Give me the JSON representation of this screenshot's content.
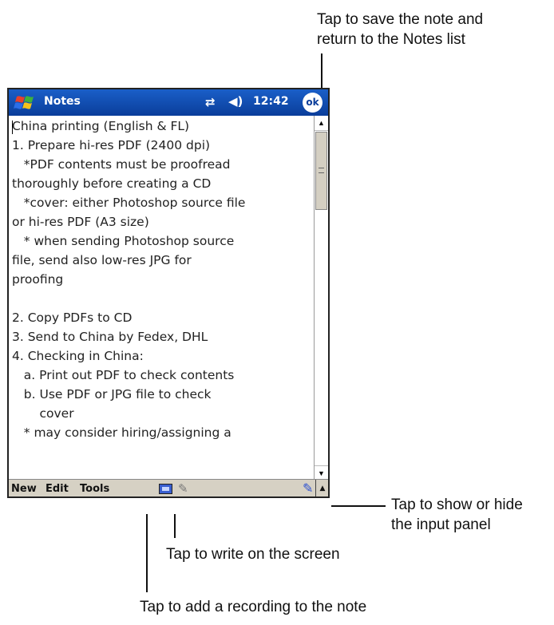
{
  "callouts": {
    "save_note": [
      "Tap to save the note and",
      "return to the Notes list"
    ],
    "input_panel": [
      "Tap to show or hide",
      "the input panel"
    ],
    "write": "Tap to write on the screen",
    "record": "Tap to add a recording to the note"
  },
  "titlebar": {
    "title": "Notes",
    "time": "12:42",
    "ok_label": "ok",
    "connectivity_icon": "connectivity-icon",
    "volume_icon": "speaker-icon"
  },
  "note": {
    "lines": [
      "China printing (English & FL)",
      "1. Prepare hi-res PDF (2400 dpi)",
      "   *PDF contents must be proofread",
      "thoroughly before creating a CD",
      "   *cover: either Photoshop source file",
      "or hi-res PDF (A3 size)",
      "   * when sending Photoshop source",
      "file, send also low-res JPG for",
      "proofing",
      "",
      "2. Copy PDFs to CD",
      "3. Send to China by Fedex, DHL",
      "4. Checking in China:",
      "   a. Print out PDF to check contents",
      "   b. Use PDF or JPG file to check",
      "       cover",
      "   * may consider hiring/assigning a"
    ]
  },
  "menubar": {
    "new": "New",
    "edit": "Edit",
    "tools": "Tools"
  },
  "colors": {
    "titlebar": "#0a3d9a",
    "menubar": "#d6d1c4"
  }
}
